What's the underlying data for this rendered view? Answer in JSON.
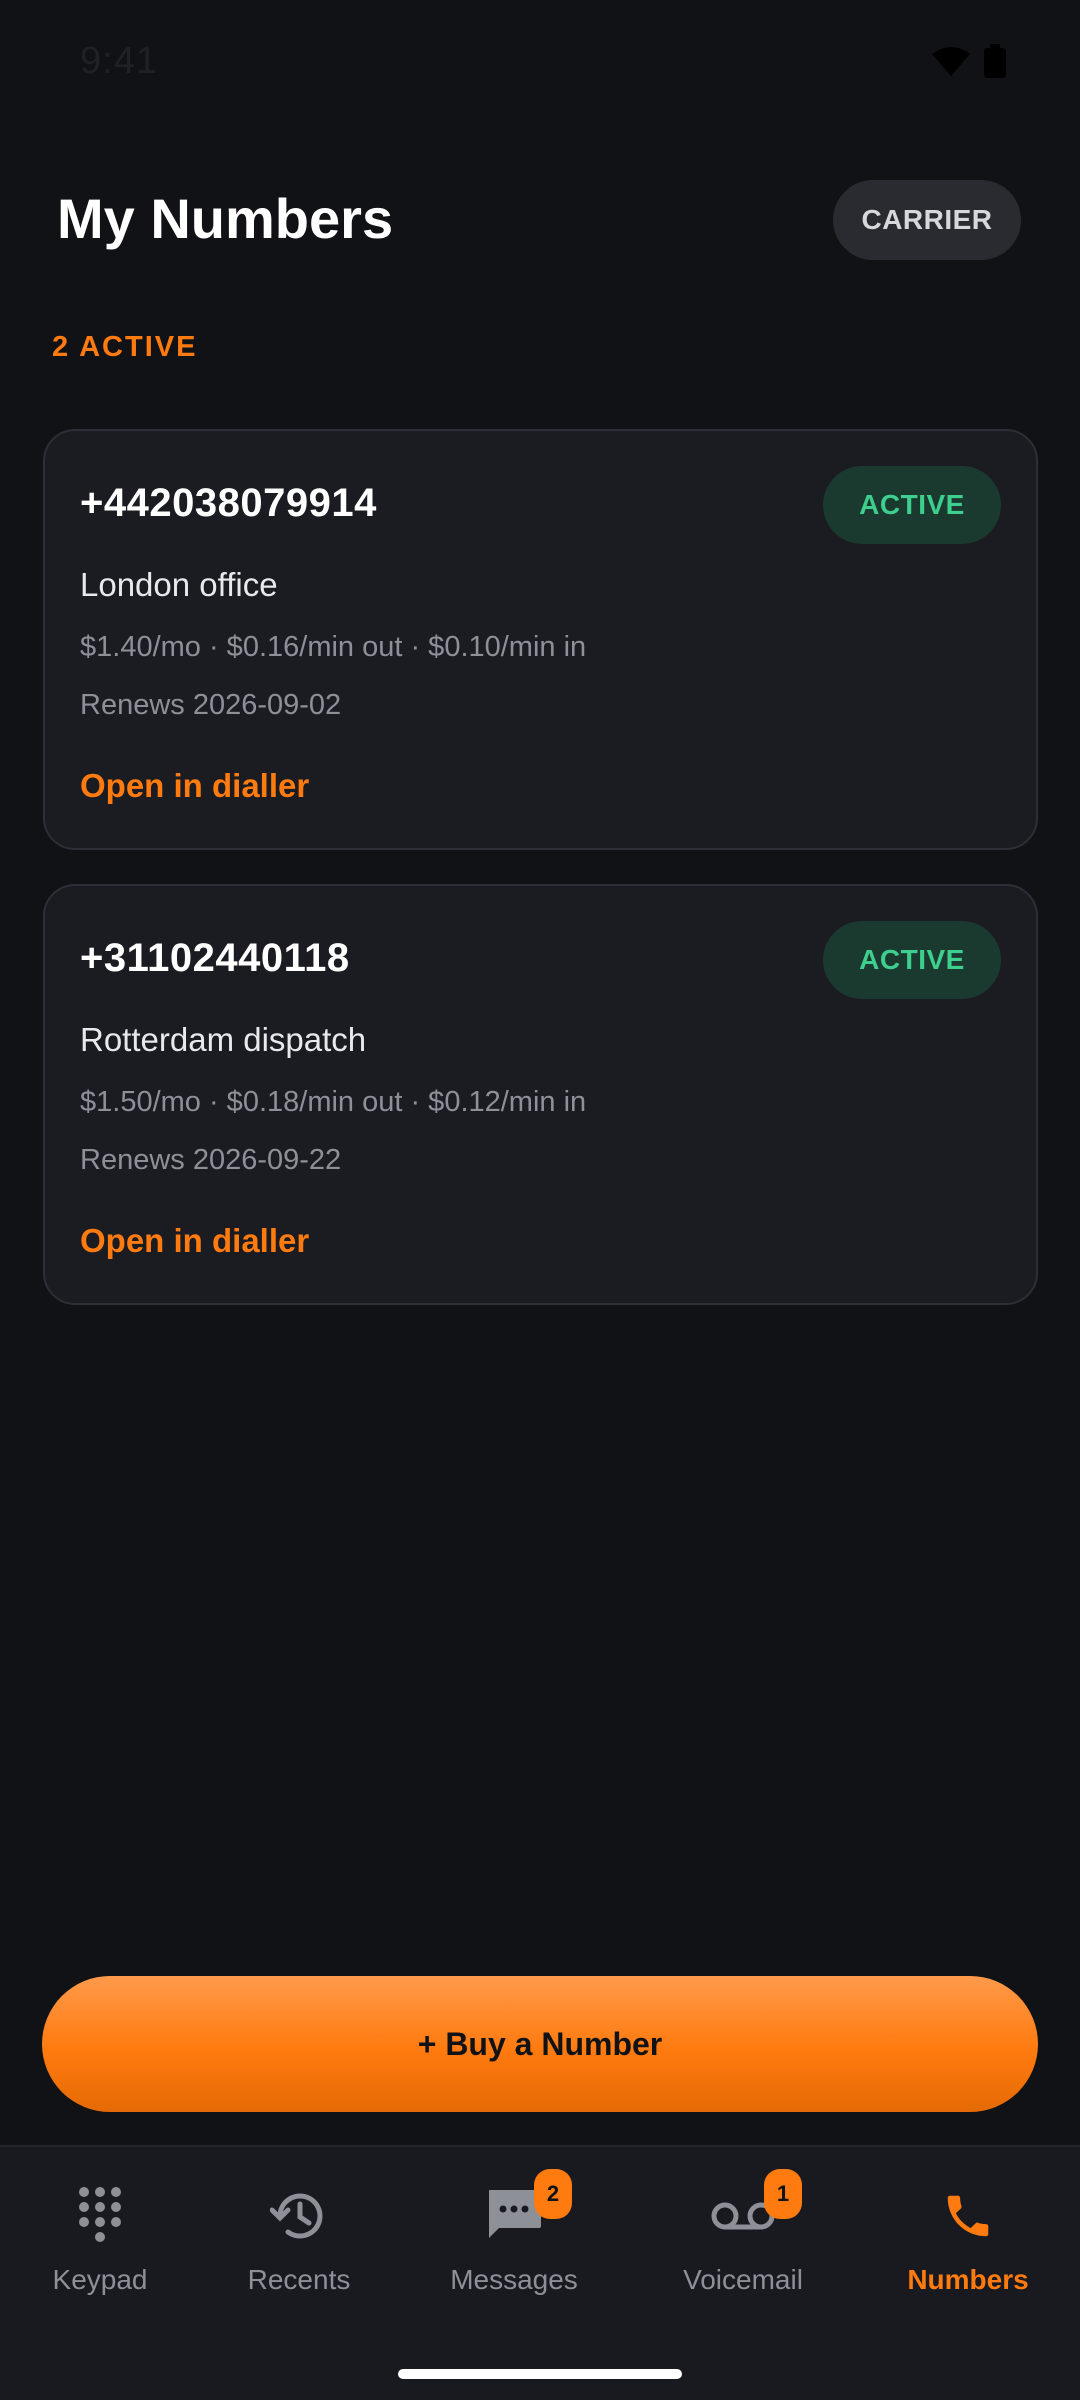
{
  "status_bar": {
    "time": "9:41"
  },
  "header": {
    "title": "My Numbers",
    "carrier_label": "CARRIER",
    "active_count": "2 ACTIVE"
  },
  "numbers": [
    {
      "number": "+442038079914",
      "status": "ACTIVE",
      "label": "London office",
      "pricing": "$1.40/mo · $0.16/min out · $0.10/min in",
      "renews": "Renews 2026-09-02",
      "link": "Open in dialler"
    },
    {
      "number": "+31102440118",
      "status": "ACTIVE",
      "label": "Rotterdam dispatch",
      "pricing": "$1.50/mo · $0.18/min out · $0.12/min in",
      "renews": "Renews 2026-09-22",
      "link": "Open in dialler"
    }
  ],
  "buy_button": {
    "label": "+ Buy a Number"
  },
  "bottom_nav": {
    "items": [
      {
        "label": "Keypad",
        "icon": "keypad-icon"
      },
      {
        "label": "Recents",
        "icon": "history-icon"
      },
      {
        "label": "Messages",
        "icon": "chat-icon",
        "badge": "2"
      },
      {
        "label": "Voicemail",
        "icon": "voicemail-icon",
        "badge": "1"
      },
      {
        "label": "Numbers",
        "icon": "phone-icon",
        "active": true
      }
    ]
  },
  "colors": {
    "accent": "#ff7a0f",
    "background": "#111216",
    "card": "#1a1c22",
    "status_active": "#3ecf8e"
  }
}
